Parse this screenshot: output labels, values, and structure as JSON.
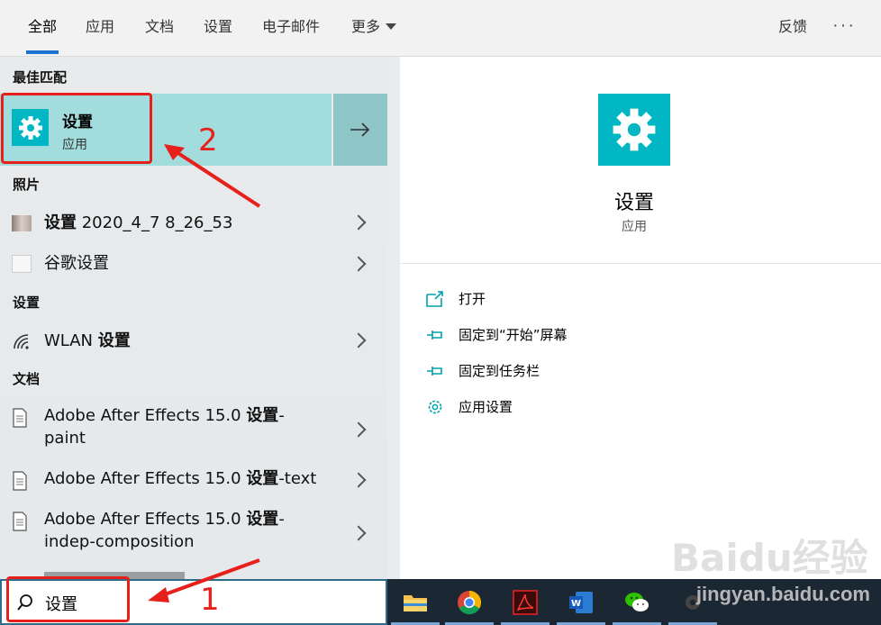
{
  "tabs": [
    {
      "label": "全部"
    },
    {
      "label": "应用"
    },
    {
      "label": "文档"
    },
    {
      "label": "设置"
    },
    {
      "label": "电子邮件"
    },
    {
      "label": "更多"
    }
  ],
  "top_right": {
    "feedback": "反馈",
    "more": "···"
  },
  "best_match": {
    "header": "最佳匹配",
    "title": "设置",
    "subtitle": "应用"
  },
  "sections": {
    "photos": "照片",
    "settings": "设置",
    "documents": "文档"
  },
  "photo_items": [
    {
      "bold": "设置",
      "rest": " 2020_4_7 8_26_53"
    },
    {
      "bold": "",
      "rest": "谷歌设置"
    }
  ],
  "settings_items": [
    {
      "rest": "WLAN ",
      "bold": "设置"
    }
  ],
  "doc_items": [
    {
      "pre": "Adobe After Effects 15.0 ",
      "bold": "设置",
      "post": "-",
      "line2": "paint"
    },
    {
      "pre": "Adobe After Effects 15.0 ",
      "bold": "设置",
      "post": "-text",
      "line2": ""
    },
    {
      "pre": "Adobe After Effects 15.0 ",
      "bold": "设置",
      "post": "-",
      "line2": "indep-composition"
    }
  ],
  "detail": {
    "title": "设置",
    "subtitle": "应用",
    "actions": [
      {
        "label": "打开",
        "icon": "open-window-icon"
      },
      {
        "label": "固定到“开始”屏幕",
        "icon": "pin-icon"
      },
      {
        "label": "固定到任务栏",
        "icon": "pin-icon"
      },
      {
        "label": "应用设置",
        "icon": "gear-icon"
      }
    ]
  },
  "search": {
    "value": "设置"
  },
  "annotations": {
    "one": "1",
    "two": "2"
  },
  "watermark": {
    "site": "jingyan.baidu.com",
    "brand": "Baidu经验"
  },
  "colors": {
    "accent": "#00b7c3",
    "highlight": "#a3dcdd",
    "annotation": "#e8201b",
    "taskbar": "#1c2734"
  }
}
